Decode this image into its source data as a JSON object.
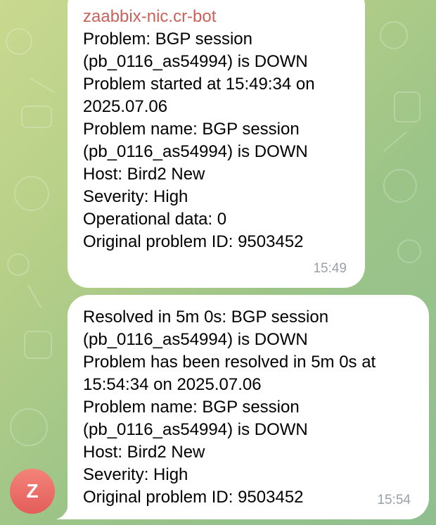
{
  "chat": {
    "messages": [
      {
        "sender": "zaabbix-nic.cr-bot",
        "lines": [
          "Problem: BGP session",
          "(pb_0116_as54994) is DOWN",
          "Problem started at 15:49:34 on",
          "2025.07.06",
          "Problem name: BGP session",
          "(pb_0116_as54994) is DOWN",
          "Host: Bird2 New",
          "Severity: High",
          "Operational data: 0",
          "Original problem ID: 9503452"
        ],
        "time": "15:49"
      },
      {
        "lines": [
          "Resolved in 5m 0s: BGP session",
          "(pb_0116_as54994) is DOWN",
          "Problem has been resolved in 5m 0s at",
          "15:54:34 on 2025.07.06",
          "Problem name: BGP session",
          "(pb_0116_as54994) is DOWN",
          "Host: Bird2 New",
          "Severity: High",
          "Original problem ID: 9503452"
        ],
        "time": "15:54"
      }
    ],
    "avatar": {
      "initial": "Z",
      "color_top": "#f4837a",
      "color_bottom": "#e35d5b"
    },
    "sender_color": "#c9625a"
  }
}
